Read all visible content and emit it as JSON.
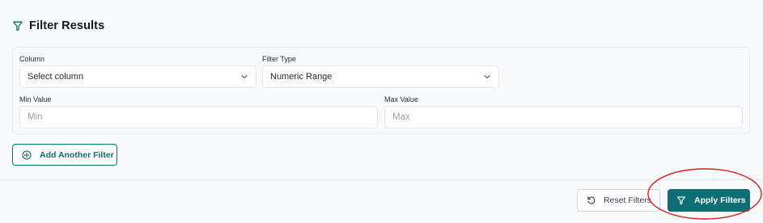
{
  "header": {
    "title": "Filter Results",
    "icon": "filter-icon"
  },
  "filters": {
    "column": {
      "label": "Column",
      "value": "Select column"
    },
    "filter_type": {
      "label": "Filter Type",
      "value": "Numeric Range"
    },
    "min": {
      "label": "Min Value",
      "placeholder": "Min"
    },
    "max": {
      "label": "Max Value",
      "placeholder": "Max"
    }
  },
  "add_button": {
    "label": "Add Another Filter",
    "icon": "plus-circle-icon"
  },
  "footer": {
    "reset_label": "Reset Filters",
    "reset_icon": "rotate-ccw-icon",
    "apply_label": "Apply Filters",
    "apply_icon": "filter-icon"
  },
  "colors": {
    "accent": "#0f6e73",
    "annotation": "#d91c1c",
    "background": "#f8fafc"
  }
}
